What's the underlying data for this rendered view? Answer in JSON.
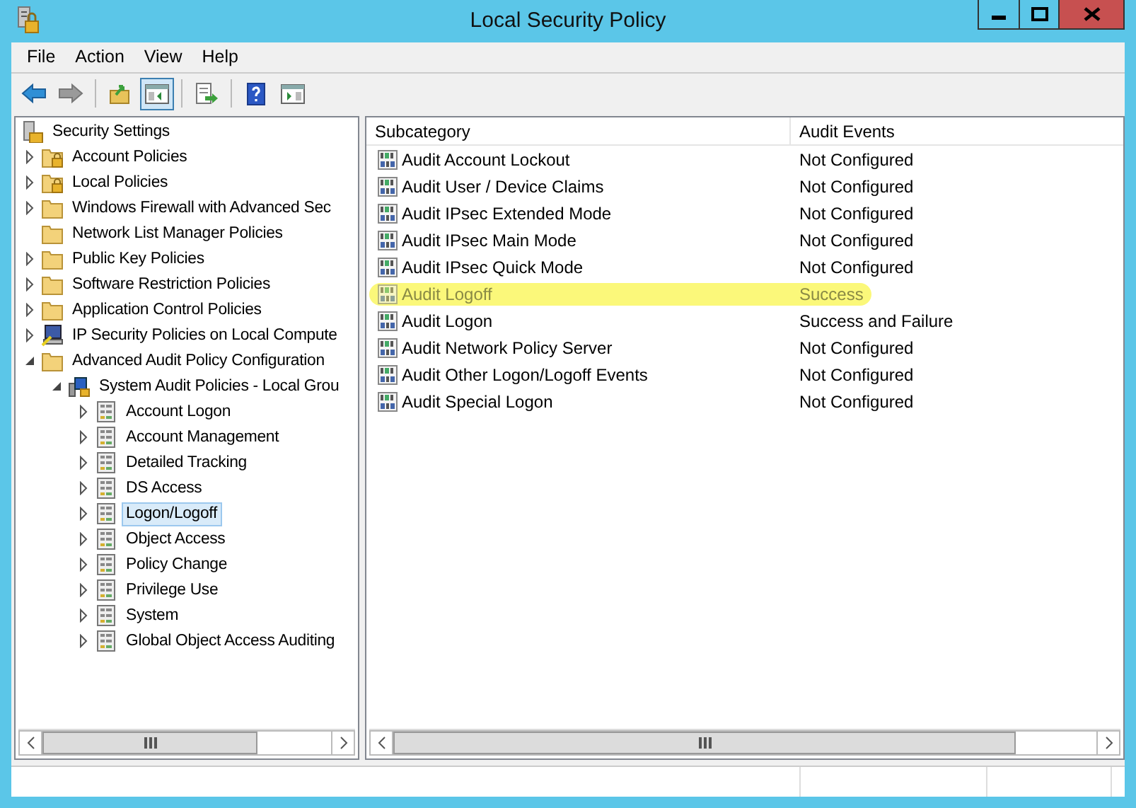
{
  "window": {
    "title": "Local Security Policy"
  },
  "menu": [
    "File",
    "Action",
    "View",
    "Help"
  ],
  "toolbar": [
    {
      "kind": "back",
      "disabled": false,
      "pressed": false
    },
    {
      "kind": "forward",
      "disabled": true,
      "pressed": false
    },
    {
      "kind": "separator"
    },
    {
      "kind": "up-folder",
      "disabled": false,
      "pressed": false
    },
    {
      "kind": "tree-toggle",
      "disabled": false,
      "pressed": true
    },
    {
      "kind": "separator"
    },
    {
      "kind": "export",
      "disabled": false,
      "pressed": false
    },
    {
      "kind": "separator"
    },
    {
      "kind": "help",
      "disabled": false,
      "pressed": false
    },
    {
      "kind": "action-pane",
      "disabled": false,
      "pressed": false
    }
  ],
  "tree": {
    "label": "Security Settings",
    "kind": "root",
    "selected": false,
    "children": [
      {
        "label": "Account Policies",
        "kind": "lock-folder",
        "expanded": false,
        "selected": false
      },
      {
        "label": "Local Policies",
        "kind": "lock-folder",
        "expanded": false,
        "selected": false
      },
      {
        "label": "Windows Firewall with Advanced Sec",
        "kind": "folder",
        "expanded": false,
        "selected": false
      },
      {
        "label": "Network List Manager Policies",
        "kind": "folder",
        "selected": false
      },
      {
        "label": "Public Key Policies",
        "kind": "folder",
        "expanded": false,
        "selected": false
      },
      {
        "label": "Software Restriction Policies",
        "kind": "folder",
        "expanded": false,
        "selected": false
      },
      {
        "label": "Application Control Policies",
        "kind": "folder",
        "expanded": false,
        "selected": false
      },
      {
        "label": "IP Security Policies on Local Compute",
        "kind": "computer",
        "expanded": false,
        "selected": false
      },
      {
        "label": "Advanced Audit Policy Configuration",
        "kind": "folder",
        "expanded": true,
        "selected": false,
        "children": [
          {
            "label": "System Audit Policies - Local Grou",
            "kind": "policy",
            "expanded": true,
            "selected": false,
            "children": [
              {
                "label": "Account Logon",
                "kind": "category",
                "expanded": false,
                "selected": false
              },
              {
                "label": "Account Management",
                "kind": "category",
                "expanded": false,
                "selected": false
              },
              {
                "label": "Detailed Tracking",
                "kind": "category",
                "expanded": false,
                "selected": false
              },
              {
                "label": "DS Access",
                "kind": "category",
                "expanded": false,
                "selected": false
              },
              {
                "label": "Logon/Logoff",
                "kind": "category",
                "expanded": false,
                "selected": true
              },
              {
                "label": "Object Access",
                "kind": "category",
                "expanded": false,
                "selected": false
              },
              {
                "label": "Policy Change",
                "kind": "category",
                "expanded": false,
                "selected": false
              },
              {
                "label": "Privilege Use",
                "kind": "category",
                "expanded": false,
                "selected": false
              },
              {
                "label": "System",
                "kind": "category",
                "expanded": false,
                "selected": false
              },
              {
                "label": "Global Object Access Auditing",
                "kind": "category",
                "expanded": false,
                "selected": false
              }
            ]
          }
        ]
      }
    ]
  },
  "table": {
    "columns": [
      "Subcategory",
      "Audit Events"
    ],
    "rows": [
      {
        "subcategory": "Audit Account Lockout",
        "audit_events": "Not Configured",
        "highlighted": false
      },
      {
        "subcategory": "Audit User / Device Claims",
        "audit_events": "Not Configured",
        "highlighted": false
      },
      {
        "subcategory": "Audit IPsec Extended Mode",
        "audit_events": "Not Configured",
        "highlighted": false
      },
      {
        "subcategory": "Audit IPsec Main Mode",
        "audit_events": "Not Configured",
        "highlighted": false
      },
      {
        "subcategory": "Audit IPsec Quick Mode",
        "audit_events": "Not Configured",
        "highlighted": false
      },
      {
        "subcategory": "Audit Logoff",
        "audit_events": "Success",
        "highlighted": true
      },
      {
        "subcategory": "Audit Logon",
        "audit_events": "Success and Failure",
        "highlighted": false
      },
      {
        "subcategory": "Audit Network Policy Server",
        "audit_events": "Not Configured",
        "highlighted": false
      },
      {
        "subcategory": "Audit Other Logon/Logoff Events",
        "audit_events": "Not Configured",
        "highlighted": false
      },
      {
        "subcategory": "Audit Special Logon",
        "audit_events": "Not Configured",
        "highlighted": false
      }
    ]
  }
}
